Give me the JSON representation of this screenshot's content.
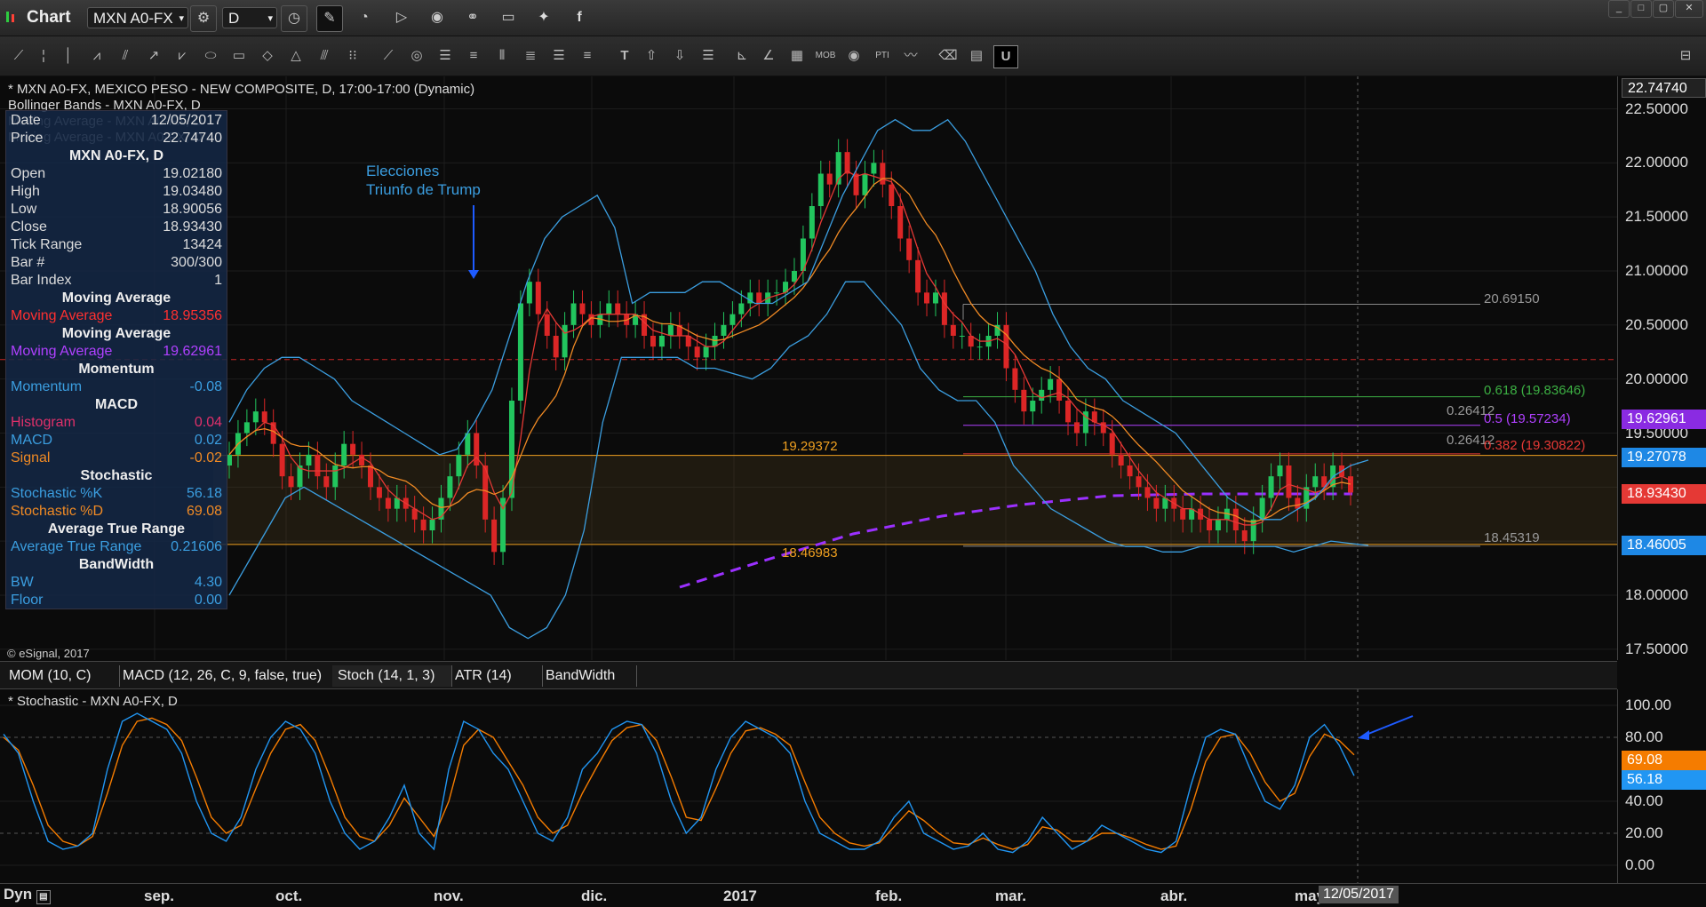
{
  "app": {
    "title": "Chart",
    "symbol": "MXN A0-FX",
    "interval": "D"
  },
  "window": {
    "min": "_",
    "restore": "□",
    "max": "▢",
    "close": "✕"
  },
  "chart_header": {
    "line1": "* MXN A0-FX, MEXICO PESO - NEW COMPOSITE, D, 17:00-17:00 (Dynamic)",
    "line2": "Bollinger Bands - MXN A0-FX, D",
    "line3": "Moving Average - MXN A0-FX, D",
    "line4": "Moving Average - MXN A0-FX, D",
    "copyright": "© eSignal, 2017"
  },
  "annotation": {
    "line1": "Elecciones",
    "line2": "Triunfo de Trump"
  },
  "levels": {
    "upper": "19.29372",
    "lower": "18.46983",
    "fib_top": "20.69150",
    "fib_618": "0.618 (19.83646)",
    "fib_5": "0.5 (19.57234)",
    "fib_382": "0.382 (19.30822)",
    "fib_a": "0.26412",
    "fib_b": "0.26412",
    "fib_bottom": "18.45319"
  },
  "data_panel": {
    "date_label": "Date",
    "date_value": "12/05/2017",
    "price_label": "Price",
    "price_value": "22.74740",
    "symbol_heading": "MXN A0-FX, D",
    "rows": [
      {
        "label": "Open",
        "value": "19.02180",
        "color": "#ddd"
      },
      {
        "label": "High",
        "value": "19.03480",
        "color": "#ddd"
      },
      {
        "label": "Low",
        "value": "18.90056",
        "color": "#ddd"
      },
      {
        "label": "Close",
        "value": "18.93430",
        "color": "#ddd"
      },
      {
        "label": "Tick Range",
        "value": "13424",
        "color": "#ddd"
      },
      {
        "label": "Bar #",
        "value": "300/300",
        "color": "#ddd"
      },
      {
        "label": "Bar Index",
        "value": "1",
        "color": "#ddd"
      }
    ],
    "ma1_heading": "Moving Average",
    "ma1_label": "Moving Average",
    "ma1_value": "18.95356",
    "ma2_heading": "Moving Average",
    "ma2_label": "Moving Average",
    "ma2_value": "19.62961",
    "mom_heading": "Momentum",
    "mom_label": "Momentum",
    "mom_value": "-0.08",
    "macd_heading": "MACD",
    "hist_label": "Histogram",
    "hist_value": "0.04",
    "macd_label": "MACD",
    "macd_value": "0.02",
    "signal_label": "Signal",
    "signal_value": "-0.02",
    "stoch_heading": "Stochastic",
    "k_label": "Stochastic %K",
    "k_value": "56.18",
    "d_label": "Stochastic %D",
    "d_value": "69.08",
    "atr_heading": "Average True Range",
    "atr_label": "Average True Range",
    "atr_value": "0.21606",
    "bw_heading": "BandWidth",
    "bw_label": "BW",
    "bw_value": "4.30",
    "floor_label": "Floor",
    "floor_value": "0.00"
  },
  "yaxis": {
    "ticks": [
      "22.50000",
      "22.00000",
      "21.50000",
      "21.00000",
      "20.50000",
      "20.00000",
      "19.50000",
      "18.00000",
      "17.50000"
    ],
    "top_flag": "22.74740",
    "flags": [
      {
        "value": "19.62961",
        "color": "#8a2be2"
      },
      {
        "value": "19.27078",
        "color": "#1e88e5"
      },
      {
        "value": "18.93430",
        "color": "#e53935"
      },
      {
        "value": "18.46005",
        "color": "#1e88e5"
      }
    ]
  },
  "tabs": [
    "MOM (10, C)",
    "MACD (12, 26, C, 9, false, true)",
    "Stoch (14, 1, 3)",
    "ATR (14)",
    "BandWidth"
  ],
  "subchart": {
    "title": "* Stochastic - MXN A0-FX, D",
    "ticks": [
      "100.00",
      "80.00",
      "40.00",
      "20.00",
      "0.00"
    ],
    "flag_d": "69.08",
    "flag_k": "56.18"
  },
  "xaxis": {
    "months": [
      "sep.",
      "oct.",
      "nov.",
      "dic.",
      "2017",
      "feb.",
      "mar.",
      "abr.",
      "may."
    ],
    "cursor_date": "12/05/2017",
    "mode": "Dyn"
  },
  "colors": {
    "candle_up": "#22c55e",
    "candle_down": "#dc2626",
    "bollinger": "#3b9ee0",
    "ma_fast": "#e53935",
    "ma_slow": "#f08a24",
    "ma_200": "#9b30ff",
    "k_line": "#2196f3",
    "d_line": "#f57c00"
  },
  "chart_data": {
    "type": "candlestick",
    "ylim": [
      17.4,
      22.8
    ],
    "close": [
      19.3,
      19.5,
      19.6,
      19.7,
      19.6,
      19.4,
      19.1,
      19.0,
      19.2,
      19.3,
      19.1,
      19.0,
      19.2,
      19.4,
      19.3,
      19.2,
      19.0,
      18.9,
      18.8,
      18.9,
      18.8,
      18.7,
      18.6,
      18.7,
      18.9,
      19.1,
      19.3,
      19.5,
      19.2,
      18.7,
      18.4,
      18.9,
      19.8,
      20.7,
      20.9,
      20.6,
      20.4,
      20.2,
      20.5,
      20.7,
      20.6,
      20.5,
      20.6,
      20.7,
      20.6,
      20.5,
      20.6,
      20.4,
      20.3,
      20.4,
      20.5,
      20.4,
      20.3,
      20.2,
      20.3,
      20.4,
      20.5,
      20.6,
      20.7,
      20.8,
      20.7,
      20.8,
      20.8,
      20.9,
      21.0,
      21.3,
      21.6,
      21.9,
      21.8,
      22.1,
      21.9,
      21.7,
      21.9,
      22.0,
      21.8,
      21.6,
      21.3,
      21.1,
      20.8,
      20.7,
      20.8,
      20.5,
      20.4,
      20.4,
      20.3,
      20.3,
      20.4,
      20.5,
      20.1,
      19.9,
      19.7,
      19.8,
      19.9,
      20.0,
      19.8,
      19.6,
      19.5,
      19.7,
      19.6,
      19.5,
      19.3,
      19.2,
      19.1,
      19.0,
      18.9,
      18.8,
      18.9,
      18.8,
      18.7,
      18.8,
      18.7,
      18.6,
      18.7,
      18.8,
      18.6,
      18.5,
      18.7,
      18.9,
      19.1,
      19.2,
      18.9,
      18.8,
      19.0,
      19.1,
      19.0,
      19.2,
      19.1,
      18.95
    ],
    "bb_upper": [
      19.6,
      19.9,
      20.1,
      20.2,
      20.2,
      20.1,
      20.0,
      19.8,
      19.7,
      19.6,
      19.5,
      19.4,
      19.3,
      19.35,
      19.6,
      19.9,
      20.4,
      20.9,
      21.3,
      21.5,
      21.6,
      21.7,
      21.4,
      20.7,
      20.8,
      20.8,
      20.8,
      20.9,
      20.9,
      20.8,
      20.7,
      20.7,
      20.8,
      20.9,
      21.3,
      21.7,
      22.0,
      22.3,
      22.4,
      22.3,
      22.3,
      22.4,
      22.2,
      21.9,
      21.6,
      21.3,
      21.0,
      20.6,
      20.3,
      20.1,
      20.0,
      19.8,
      19.7,
      19.6,
      19.5,
      19.3,
      19.1,
      18.9,
      18.8,
      18.7,
      18.7,
      18.8,
      18.9,
      19.1,
      19.2,
      19.25
    ],
    "bb_lower": [
      18.0,
      18.3,
      18.6,
      18.9,
      19.0,
      18.9,
      18.8,
      18.7,
      18.6,
      18.5,
      18.4,
      18.3,
      18.2,
      18.1,
      18.0,
      17.7,
      17.6,
      17.7,
      18.0,
      18.6,
      19.6,
      20.2,
      20.2,
      20.2,
      20.2,
      20.1,
      20.1,
      20.05,
      20.0,
      20.1,
      20.3,
      20.4,
      20.6,
      20.9,
      20.9,
      20.7,
      20.5,
      20.1,
      19.9,
      19.8,
      19.8,
      19.6,
      19.2,
      19.0,
      18.8,
      18.7,
      18.6,
      18.5,
      18.45,
      18.45,
      18.4,
      18.4,
      18.45,
      18.45,
      18.45,
      18.45,
      18.45,
      18.4,
      18.45,
      18.5,
      18.48,
      18.46
    ],
    "k": [
      82,
      70,
      40,
      15,
      10,
      12,
      20,
      60,
      90,
      95,
      90,
      85,
      70,
      40,
      20,
      15,
      30,
      60,
      80,
      90,
      85,
      70,
      40,
      20,
      10,
      15,
      30,
      50,
      20,
      10,
      60,
      90,
      85,
      70,
      60,
      40,
      20,
      15,
      30,
      60,
      70,
      85,
      90,
      88,
      70,
      40,
      20,
      30,
      60,
      80,
      90,
      85,
      80,
      70,
      40,
      20,
      15,
      10,
      10,
      15,
      30,
      40,
      20,
      15,
      10,
      12,
      20,
      10,
      8,
      15,
      30,
      20,
      10,
      15,
      25,
      20,
      15,
      10,
      8,
      15,
      50,
      80,
      85,
      82,
      60,
      40,
      35,
      50,
      80,
      88,
      75,
      56
    ],
    "d": [
      80,
      72,
      50,
      25,
      15,
      12,
      18,
      45,
      75,
      90,
      92,
      88,
      78,
      55,
      30,
      20,
      25,
      48,
      70,
      85,
      88,
      78,
      55,
      30,
      18,
      15,
      25,
      42,
      30,
      18,
      40,
      75,
      85,
      80,
      65,
      50,
      30,
      20,
      25,
      45,
      62,
      78,
      86,
      88,
      78,
      55,
      30,
      28,
      48,
      70,
      84,
      86,
      82,
      75,
      52,
      30,
      20,
      14,
      12,
      14,
      24,
      34,
      28,
      20,
      14,
      13,
      17,
      13,
      10,
      13,
      24,
      22,
      15,
      15,
      20,
      20,
      17,
      13,
      10,
      12,
      35,
      65,
      80,
      82,
      70,
      52,
      40,
      45,
      68,
      82,
      78,
      69
    ]
  }
}
